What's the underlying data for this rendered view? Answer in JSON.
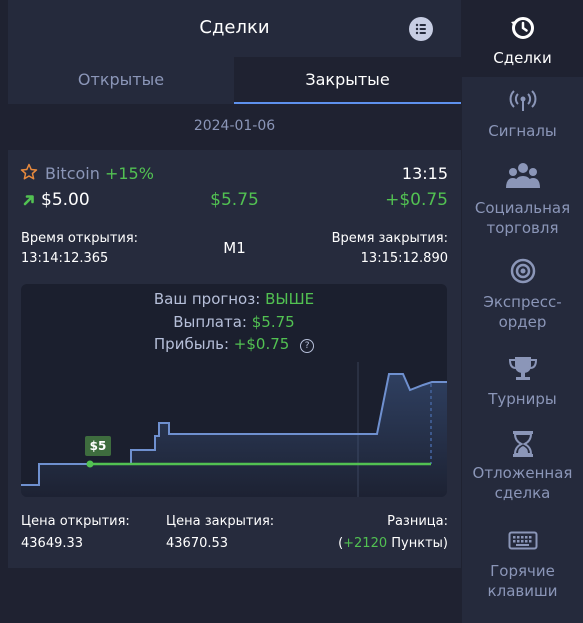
{
  "header": {
    "title": "Сделки"
  },
  "tabs": [
    {
      "label": "Открытые",
      "active": false
    },
    {
      "label": "Закрытые",
      "active": true
    }
  ],
  "date": "2024-01-06",
  "trade": {
    "asset": "Bitcoin",
    "percent": "+15%",
    "time": "13:15",
    "amount": "$5.00",
    "payout": "$5.75",
    "profit": "+$0.75",
    "open_label": "Время открытия:",
    "open_time": "13:14:12.365",
    "timeframe": "M1",
    "close_label": "Время закрытия:",
    "close_time": "13:15:12.890",
    "forecast_label": "Ваш прогноз:",
    "forecast_value": "ВЫШЕ",
    "payout_label": "Выплата:",
    "payout_value": "$5.75",
    "profit_label": "Прибыль:",
    "profit_value": "+$0.75",
    "chart_badge": "$5",
    "open_price_label": "Цена открытия:",
    "open_price": "43649.33",
    "close_price_label": "Цена закрытия:",
    "close_price": "43670.53",
    "diff_label": "Разница:",
    "diff_open": "(",
    "diff_points": "+2120",
    "diff_unit": " Пункты)"
  },
  "sidebar": [
    {
      "label": "Сделки",
      "icon": "trades-history-icon",
      "active": true
    },
    {
      "label": "Сигналы",
      "icon": "signal-antenna-icon",
      "active": false
    },
    {
      "label": "Социальная торговля",
      "icon": "social-group-icon",
      "active": false
    },
    {
      "label": "Экспресс-ордер",
      "icon": "express-target-icon",
      "active": false
    },
    {
      "label": "Турниры",
      "icon": "trophy-icon",
      "active": false
    },
    {
      "label": "Отложенная сделка",
      "icon": "hourglass-icon",
      "active": false
    },
    {
      "label": "Горячие клавиши",
      "icon": "keyboard-icon",
      "active": false
    }
  ],
  "colors": {
    "up": "#52c152",
    "accent": "#5e91ed",
    "muted": "#8b96b8"
  }
}
